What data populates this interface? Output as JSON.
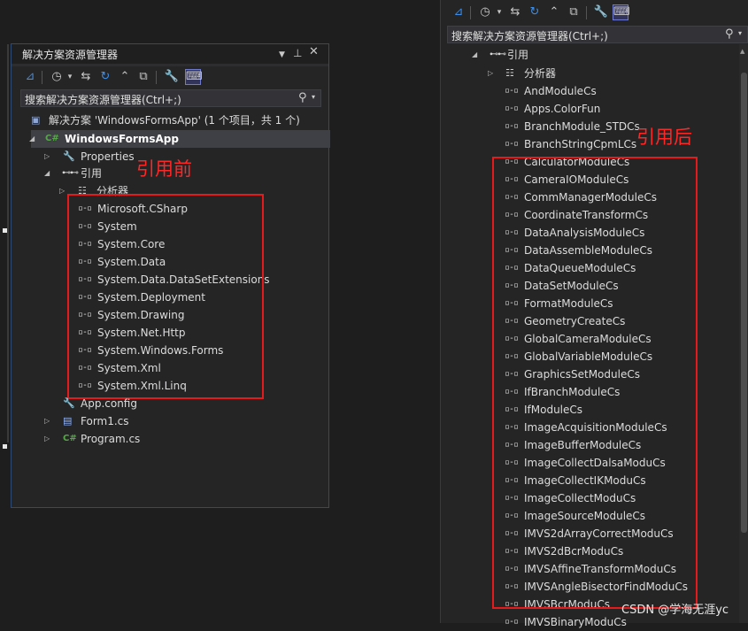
{
  "left_panel": {
    "title": "解决方案资源管理器",
    "search_placeholder": "搜索解决方案资源管理器(Ctrl+;)",
    "solution_label": "解决方案 'WindowsFormsApp' (1 个项目，共 1 个)",
    "project_name": "WindowsFormsApp",
    "properties_label": "Properties",
    "references_label": "引用",
    "analyzer_label": "分析器",
    "references": [
      "Microsoft.CSharp",
      "System",
      "System.Core",
      "System.Data",
      "System.Data.DataSetExtensions",
      "System.Deployment",
      "System.Drawing",
      "System.Net.Http",
      "System.Windows.Forms",
      "System.Xml",
      "System.Xml.Linq"
    ],
    "files": [
      "App.config",
      "Form1.cs",
      "Program.cs"
    ],
    "annotation": "引用前"
  },
  "right_panel": {
    "search_placeholder": "搜索解决方案资源管理器(Ctrl+;)",
    "references_label": "引用",
    "analyzer_label": "分析器",
    "references": [
      "AndModuleCs",
      "Apps.ColorFun",
      "BranchModule_STDCs",
      "BranchStringCpmLCs",
      "CalculatorModuleCs",
      "CameraIOModuleCs",
      "CommManagerModuleCs",
      "CoordinateTransformCs",
      "DataAnalysisModuleCs",
      "DataAssembleModuleCs",
      "DataQueueModuleCs",
      "DataSetModuleCs",
      "FormatModuleCs",
      "GeometryCreateCs",
      "GlobalCameraModuleCs",
      "GlobalVariableModuleCs",
      "GraphicsSetModuleCs",
      "IfBranchModuleCs",
      "IfModuleCs",
      "ImageAcquisitionModuleCs",
      "ImageBufferModuleCs",
      "ImageCollectDalsaModuCs",
      "ImageCollectIKModuCs",
      "ImageCollectModuCs",
      "ImageSourceModuleCs",
      "IMVS2dArrayCorrectModuCs",
      "IMVS2dBcrModuCs",
      "IMVSAffineTransformModuCs",
      "IMVSAngleBisectorFindModuCs",
      "IMVSBcrModuCs",
      "IMVSBinaryModuCs"
    ],
    "annotation": "引用后"
  },
  "watermark": "CSDN @学海无涯yc",
  "icons": {
    "reference": "reference-icon",
    "pin": "pin-icon",
    "close": "close-icon",
    "search": "search-icon",
    "wrench": "wrench-icon",
    "csharp": "csharp-file-icon"
  },
  "colors": {
    "annotation_red": "#e51b1b",
    "background": "#1e1e1e",
    "panel": "#252526",
    "selected_row": "#3f3f46"
  }
}
